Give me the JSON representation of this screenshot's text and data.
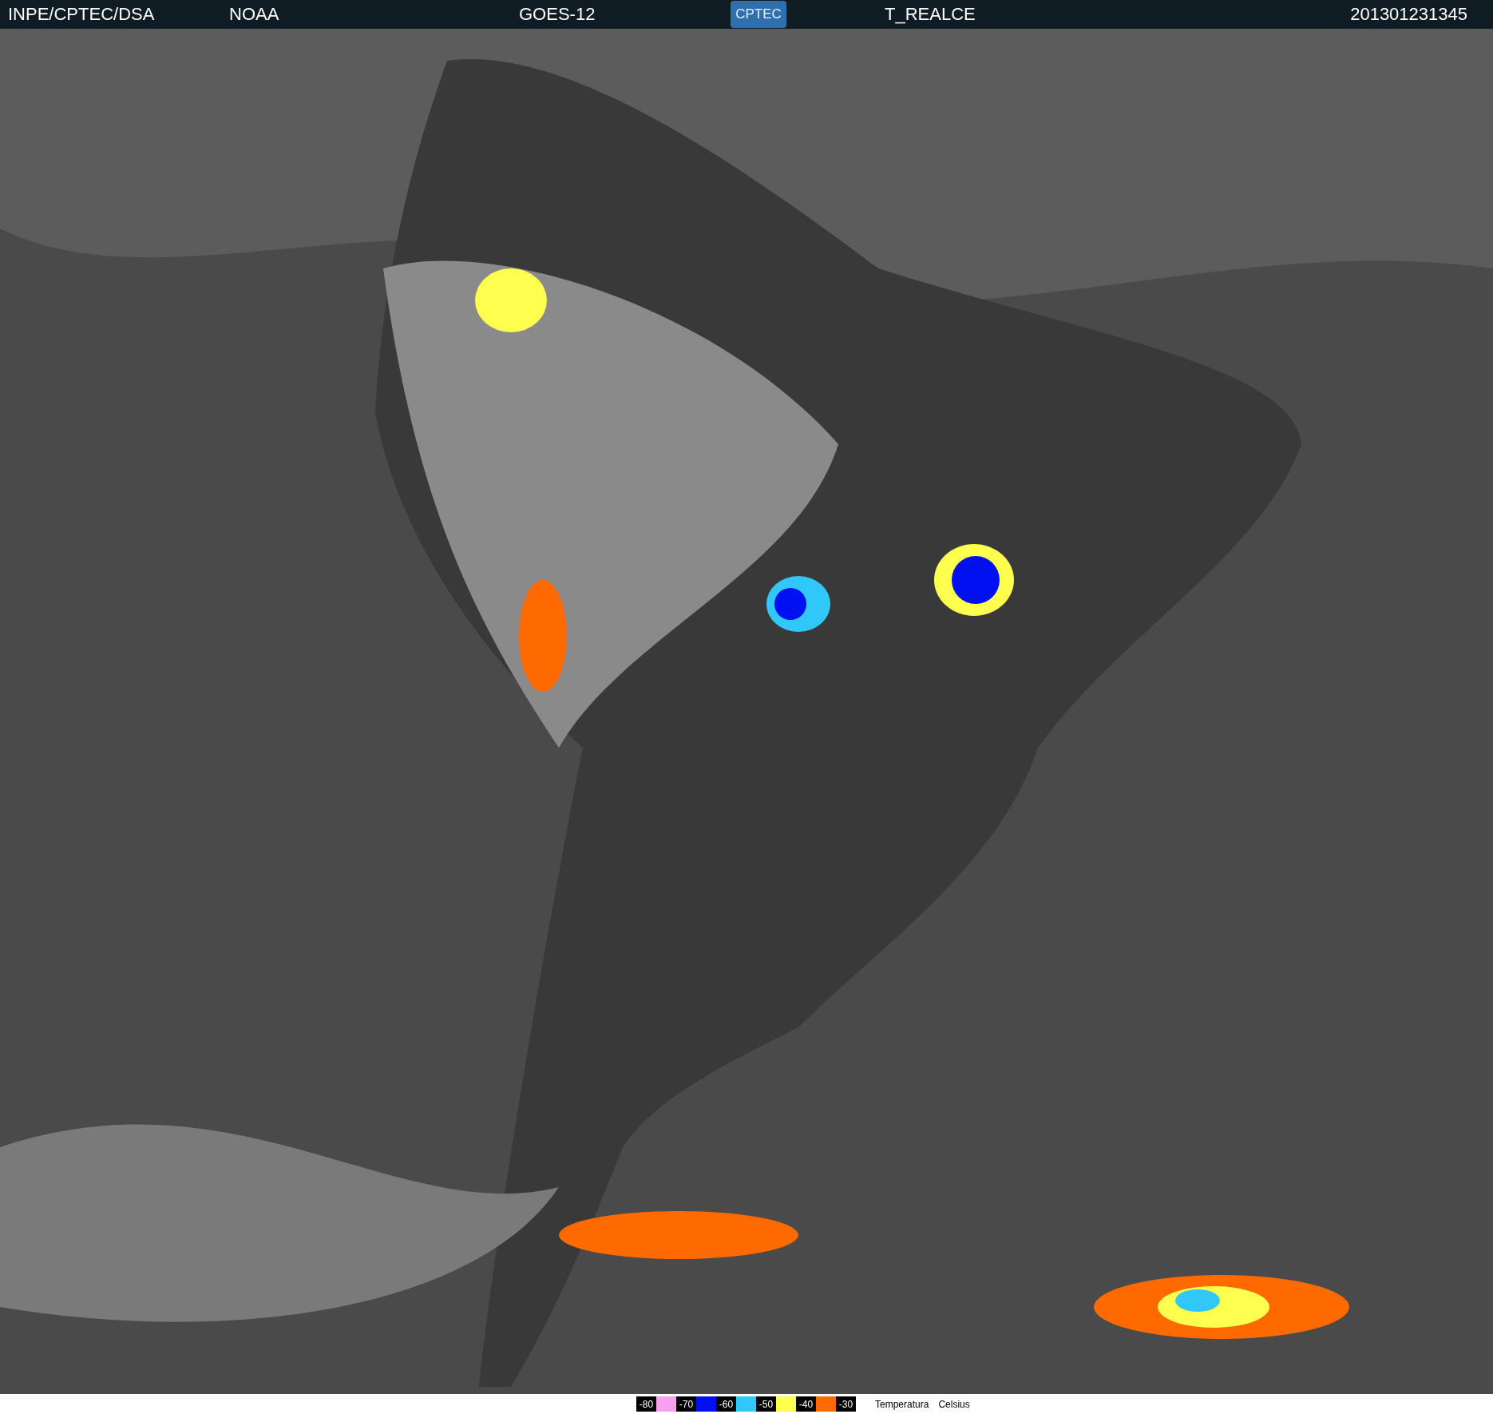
{
  "header": {
    "items": [
      {
        "kind": "text",
        "text": "INPE/CPTEC/DSA"
      },
      {
        "kind": "text",
        "text": "NOAA"
      },
      {
        "kind": "text",
        "text": "GOES-12"
      },
      {
        "kind": "logo",
        "text": "CPTEC"
      },
      {
        "kind": "text",
        "text": "T_REALCE"
      },
      {
        "kind": "text",
        "text": "201301231345"
      }
    ]
  },
  "legend": {
    "steps": [
      {
        "label": "-80",
        "color": "#f5a0f0"
      },
      {
        "label": "-70",
        "color": "#0010f0"
      },
      {
        "label": "-60",
        "color": "#30c8f8"
      },
      {
        "label": "-50",
        "color": "#ffff50"
      },
      {
        "label": "-40",
        "color": "#ff6a00"
      },
      {
        "label": "-30"
      }
    ],
    "captions": [
      "Temperatura",
      "Celsius"
    ]
  }
}
